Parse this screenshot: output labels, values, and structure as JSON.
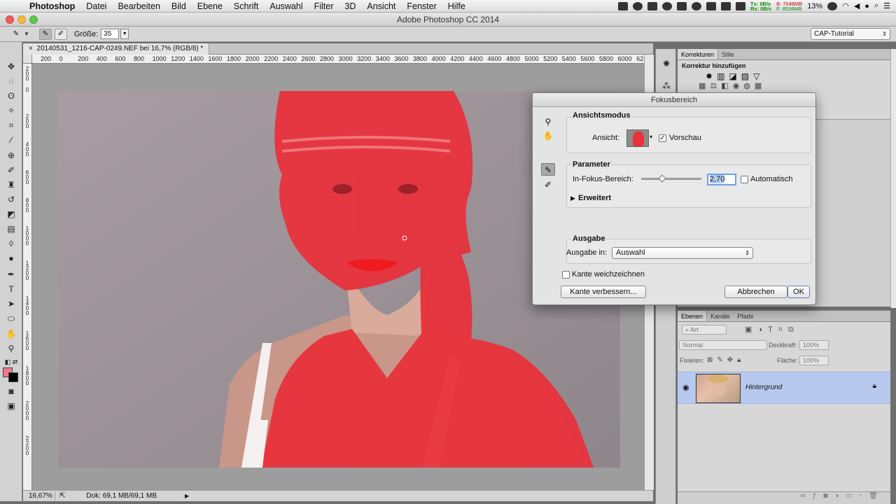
{
  "menubar": {
    "app_name": "Photoshop",
    "items": [
      "Datei",
      "Bearbeiten",
      "Bild",
      "Ebene",
      "Schrift",
      "Auswahl",
      "Filter",
      "3D",
      "Ansicht",
      "Fenster",
      "Hilfe"
    ],
    "net_tx": "Tx:",
    "net_rx": "Rx:",
    "net_tx_rate": "0B/s",
    "net_rx_rate": "0B/s",
    "mem_b": "B: 7048MB",
    "mem_f": "F: 8536MB",
    "battery": "13%"
  },
  "window": {
    "title": "Adobe Photoshop CC 2014"
  },
  "options": {
    "size_label": "Größe:",
    "size_value": "35",
    "workspace": "CAP-Tutorial"
  },
  "document": {
    "tab_label": "20140531_1216-CAP-0249.NEF bei 16,7% (RGB/8) *",
    "ruler_h": [
      "200",
      "0",
      "200",
      "400",
      "600",
      "800",
      "1000",
      "1200",
      "1400",
      "1600",
      "1800",
      "2000",
      "2200",
      "2400",
      "2600",
      "2800",
      "3000",
      "3200",
      "3400",
      "3600",
      "3800",
      "4000",
      "4200",
      "4400",
      "4600",
      "4800",
      "5000",
      "5200",
      "5400",
      "5600",
      "5800",
      "6000",
      "62"
    ],
    "zoom": "16,67%",
    "doc_size": "Dok: 69,1 MB/69,1 MB"
  },
  "panels": {
    "adjust_tabs": [
      "Korrekturen",
      "Stile"
    ],
    "adjust_add": "Korrektur hinzufügen",
    "layers_tabs": [
      "Ebenen",
      "Kanäle",
      "Pfade"
    ],
    "layer_filter": "Art",
    "blend_mode": "Normal",
    "opacity_label": "Deckkraft:",
    "opacity_value": "100%",
    "lock_label": "Fixieren:",
    "fill_label": "Fläche:",
    "fill_value": "100%",
    "layer_name": "Hintergrund"
  },
  "dialog": {
    "title": "Fokusbereich",
    "view_mode_title": "Ansichtsmodus",
    "view_label": "Ansicht:",
    "preview_label": "Vorschau",
    "preview_checked": true,
    "params_title": "Parameter",
    "infocus_label": "In-Fokus-Bereich:",
    "infocus_value": "2,70",
    "slider_position": 0.35,
    "auto_label": "Automatisch",
    "auto_checked": false,
    "advanced_label": "Erweitert",
    "output_title": "Ausgabe",
    "output_label": "Ausgabe in:",
    "output_value": "Auswahl",
    "soften_label": "Kante weichzeichnen",
    "soften_checked": false,
    "refine_button": "Kante verbessern...",
    "cancel_button": "Abbrechen",
    "ok_button": "OK"
  },
  "colors": {
    "selection_overlay": "#e8323c",
    "foreground_swatch": "#f07a88",
    "background_swatch": "#000000",
    "selected_layer": "#b7c9ef"
  }
}
